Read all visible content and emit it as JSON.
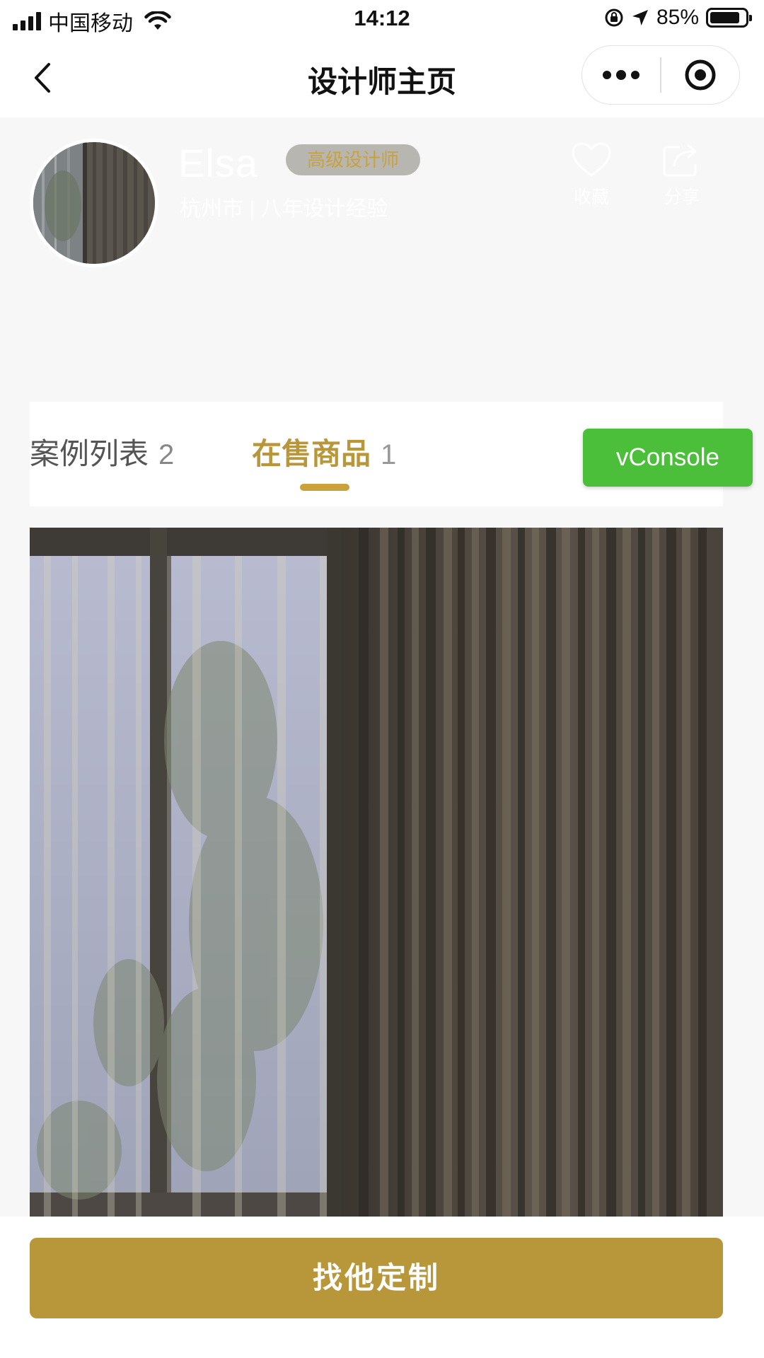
{
  "status_bar": {
    "carrier": "中国移动",
    "time": "14:12",
    "battery": "85%",
    "battery_level": 0.85
  },
  "nav": {
    "title": "设计师主页",
    "back_icon": "chevron-left-icon",
    "more_icon": "more-dots-icon",
    "close_icon": "record-circle-icon"
  },
  "profile": {
    "name": "Elsa",
    "badge": "高级设计师",
    "subtitle": "杭州市 | 八年设计经验",
    "favorite_label": "收藏",
    "share_label": "分享"
  },
  "tabs": [
    {
      "label": "案例列表",
      "count": "2",
      "active": false
    },
    {
      "label": "在售商品",
      "count": "1",
      "active": true
    }
  ],
  "vconsole": {
    "label": "vConsole"
  },
  "bottom": {
    "cta_label": "找他定制"
  },
  "colors": {
    "accent": "#b8963a",
    "vconsole": "#4cbf3a",
    "background": "#f7f7f7"
  }
}
